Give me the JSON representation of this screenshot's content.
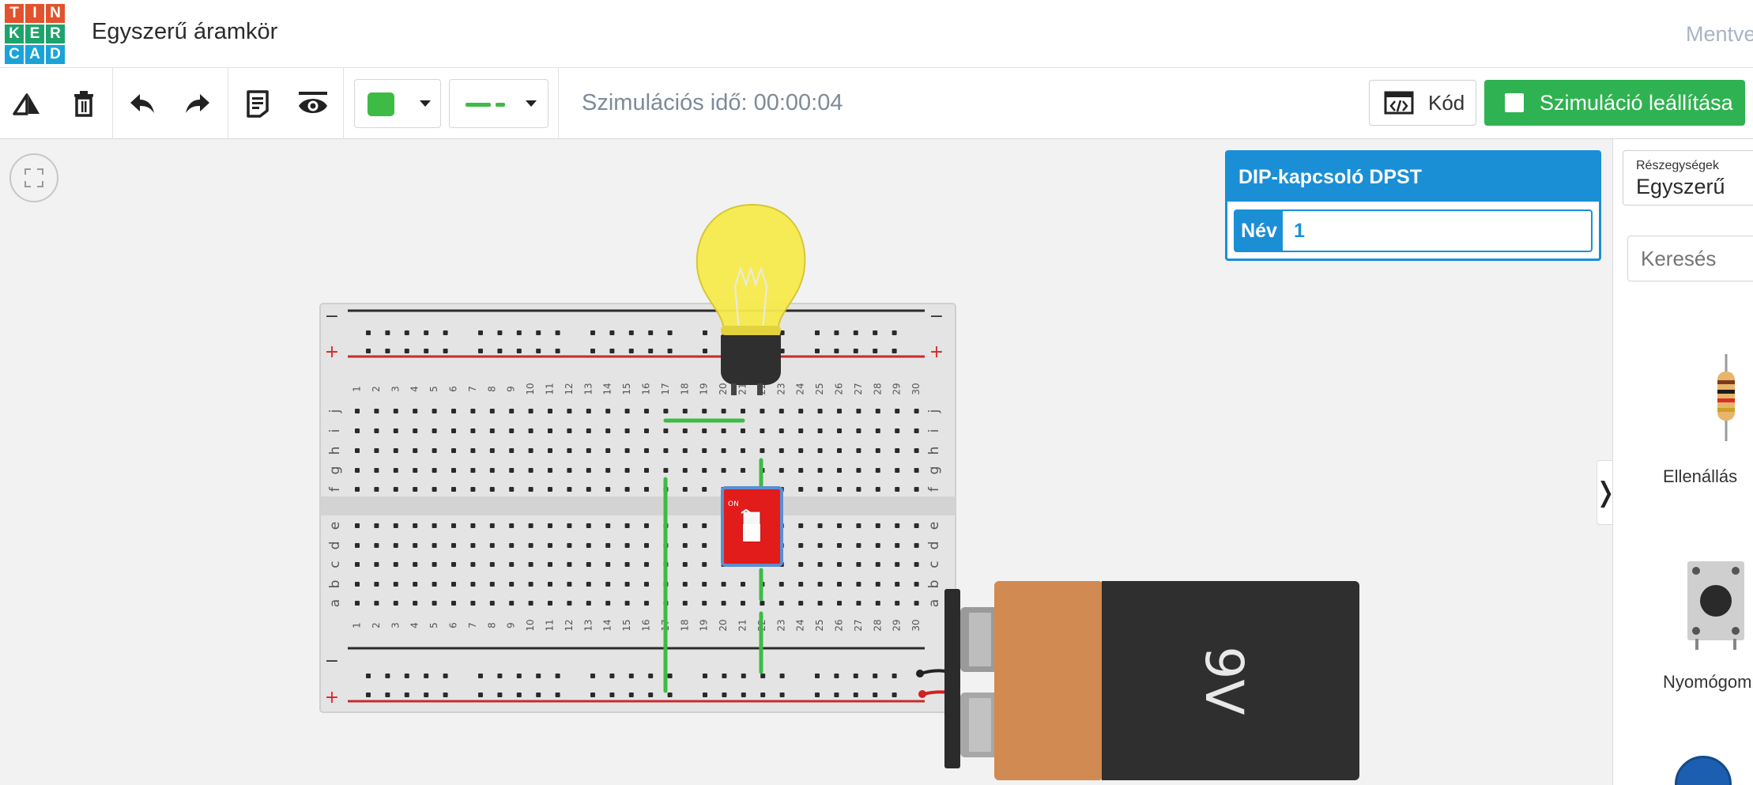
{
  "header": {
    "logo_letters": [
      "T",
      "I",
      "N",
      "K",
      "E",
      "R",
      "C",
      "A",
      "D"
    ],
    "logo_colors": [
      "#e2522d",
      "#e2522d",
      "#e2522d",
      "#1ea36c",
      "#1ea36c",
      "#1ea36c",
      "#1aa3d9",
      "#1aa3d9",
      "#1aa3d9"
    ],
    "title": "Egyszerű áramkör",
    "save_status": "Mentve"
  },
  "toolbar": {
    "sim_time": "Szimulációs idő: 00:00:04",
    "color_swatch": "#3dbb45",
    "code_label": "Kód",
    "sim_button_label": "Szimuláció leállítása",
    "icons": [
      "rotate-icon",
      "delete-icon",
      "undo-icon",
      "redo-icon",
      "notes-icon",
      "visibility-icon",
      "color-dropdown",
      "line-style-dropdown"
    ]
  },
  "inspector": {
    "title": "DIP-kapcsoló DPST",
    "name_label": "Név",
    "name_value": "1"
  },
  "panel": {
    "components_small_label": "Részegységek",
    "components_value": "Egyszerű",
    "search_placeholder": "Keresés",
    "items": [
      {
        "name": "Ellenállás"
      },
      {
        "name": "Nyomógomb"
      }
    ]
  },
  "breadboard": {
    "top_row_labels": [
      "1",
      "2",
      "3",
      "4",
      "5",
      "6",
      "7",
      "8",
      "9",
      "10",
      "11",
      "12",
      "13",
      "14",
      "15",
      "16",
      "17",
      "18",
      "19",
      "20",
      "21",
      "22",
      "23",
      "24",
      "25",
      "26",
      "27",
      "28",
      "29",
      "30"
    ],
    "rows_top": [
      "j",
      "i",
      "h",
      "g",
      "f"
    ],
    "rows_bottom": [
      "e",
      "d",
      "c",
      "b",
      "a"
    ],
    "rail_minus": "−",
    "rail_plus": "+"
  },
  "battery": {
    "label": "9V"
  },
  "colors": {
    "accent_blue": "#1b8fd6",
    "sim_green": "#2fb251",
    "wire_green": "#3dbb45",
    "switch_red": "#e21b1b",
    "bulb_yellow": "#f8eb4d",
    "battery_copper": "#d18a51",
    "battery_body": "#2f2f2f"
  }
}
